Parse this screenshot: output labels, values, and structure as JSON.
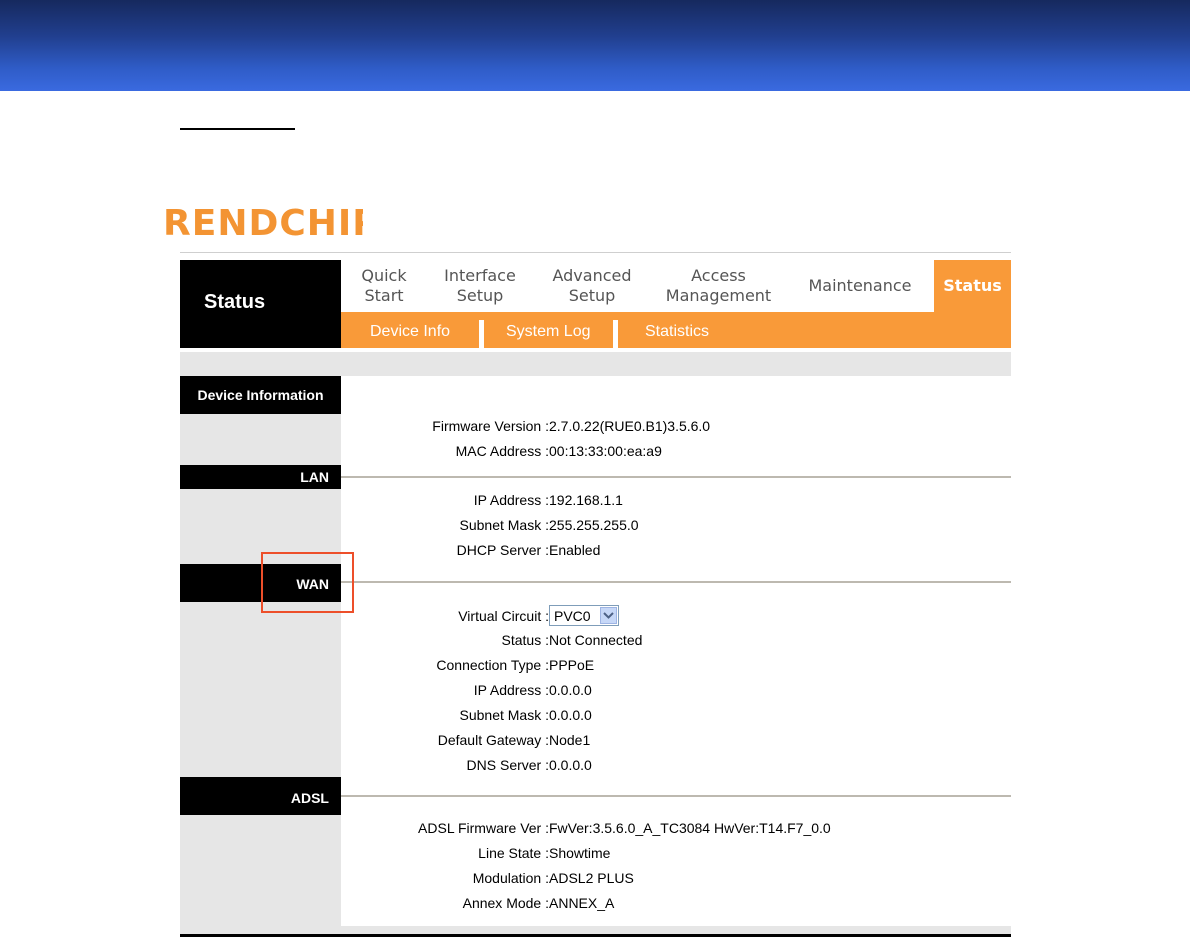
{
  "brand": {
    "logo_text": "RENDCHIP"
  },
  "header": {
    "title": "Status"
  },
  "nav": {
    "items": [
      {
        "line1": "Quick",
        "line2": "Start"
      },
      {
        "line1": "Interface",
        "line2": "Setup"
      },
      {
        "line1": "Advanced",
        "line2": "Setup"
      },
      {
        "line1": "Access",
        "line2": "Management"
      },
      {
        "line1": "Maintenance",
        "line2": ""
      },
      {
        "line1": "Status",
        "line2": ""
      }
    ],
    "active": "Status"
  },
  "subnav": {
    "items": [
      "Device Info",
      "System Log",
      "Statistics"
    ]
  },
  "sections": {
    "device": {
      "title": "Device Information",
      "firmware_label": "Firmware Version :",
      "firmware_value": "2.7.0.22(RUE0.B1)3.5.6.0",
      "mac_label": "MAC Address :",
      "mac_value": "00:13:33:00:ea:a9"
    },
    "lan": {
      "title": "LAN",
      "ip_label": "IP Address :",
      "ip_value": "192.168.1.1",
      "mask_label": "Subnet Mask :",
      "mask_value": "255.255.255.0",
      "dhcp_label": "DHCP Server :",
      "dhcp_value": "Enabled"
    },
    "wan": {
      "title": "WAN",
      "vc_label": "Virtual Circuit :",
      "vc_value": "PVC0",
      "status_label": "Status :",
      "status_value": "Not Connected",
      "conn_label": "Connection Type :",
      "conn_value": "PPPoE",
      "ip_label": "IP Address :",
      "ip_value": "0.0.0.0",
      "mask_label": "Subnet Mask :",
      "mask_value": "0.0.0.0",
      "gw_label": "Default Gateway :",
      "gw_value": "Node1",
      "dns_label": "DNS Server :",
      "dns_value": "0.0.0.0"
    },
    "adsl": {
      "title": "ADSL",
      "fw_label": "ADSL Firmware Ver :",
      "fw_value": "FwVer:3.5.6.0_A_TC3084 HwVer:T14.F7_0.0",
      "line_label": "Line State :",
      "line_value": "Showtime",
      "mod_label": "Modulation :",
      "mod_value": "ADSL2 PLUS",
      "annex_label": "Annex Mode :",
      "annex_value": "ANNEX_A"
    }
  },
  "colors": {
    "accent": "#f99a39",
    "banner": "#2f5cc7",
    "highlight": "#ed4f2a"
  }
}
